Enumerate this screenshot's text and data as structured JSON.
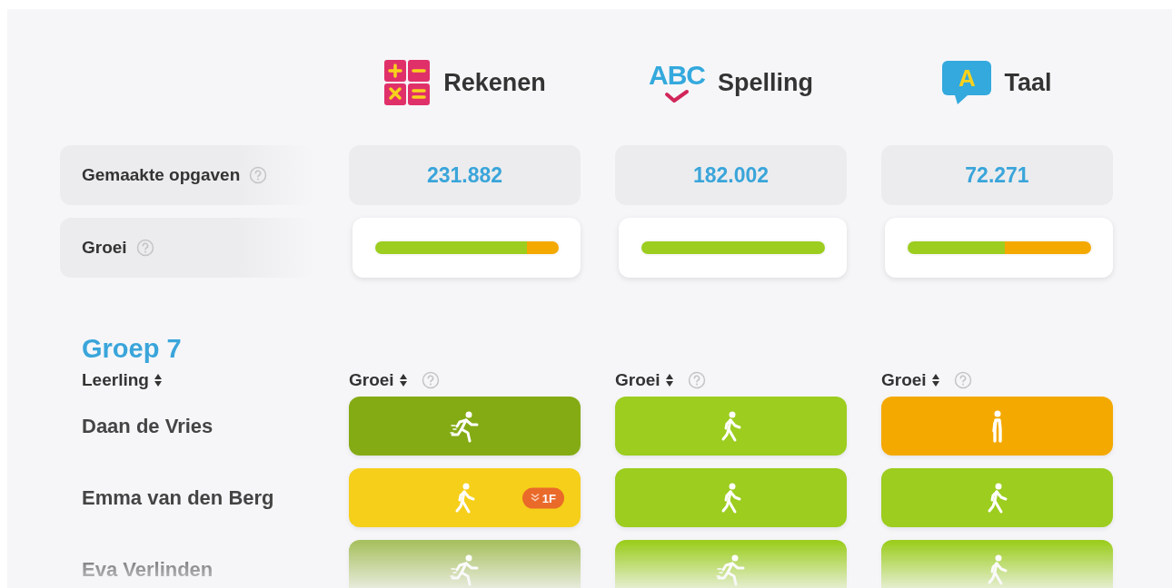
{
  "subjects": [
    {
      "name": "Rekenen",
      "kind": "calculator"
    },
    {
      "name": "Spelling",
      "kind": "abc",
      "icon_text": "ABC"
    },
    {
      "name": "Taal",
      "kind": "speech",
      "icon_text": "A"
    }
  ],
  "stats": {
    "label": "Gemaakte opgaven",
    "values": [
      "231.882",
      "182.002",
      "72.271"
    ]
  },
  "growth": {
    "label": "Groei",
    "bars": [
      {
        "level": 0.83
      },
      {
        "level": 1
      },
      {
        "level": 0.53
      }
    ]
  },
  "group": {
    "title": "Groep 7",
    "student_header": "Leerling",
    "column_headers": [
      "Groei",
      "Groei",
      "Groei"
    ],
    "students": [
      {
        "name": "Daan de Vries",
        "cells": [
          {
            "kind": "run",
            "color": "#84ab14"
          },
          {
            "kind": "walk",
            "color": "#9ccd1f"
          },
          {
            "kind": "stand",
            "color": "#f4a900"
          }
        ]
      },
      {
        "name": "Emma van den Berg",
        "cells": [
          {
            "kind": "walk",
            "color": "#f5cf1a",
            "badge": "1F"
          },
          {
            "kind": "walk",
            "color": "#9ccd1f"
          },
          {
            "kind": "walk",
            "color": "#9ccd1f"
          }
        ]
      },
      {
        "name": "Eva Verlinden",
        "cells": [
          {
            "kind": "run",
            "color": "#a8c060"
          },
          {
            "kind": "run",
            "color": "#9ccd1f"
          },
          {
            "kind": "walk",
            "color": "#9ccd1f"
          }
        ]
      }
    ]
  }
}
